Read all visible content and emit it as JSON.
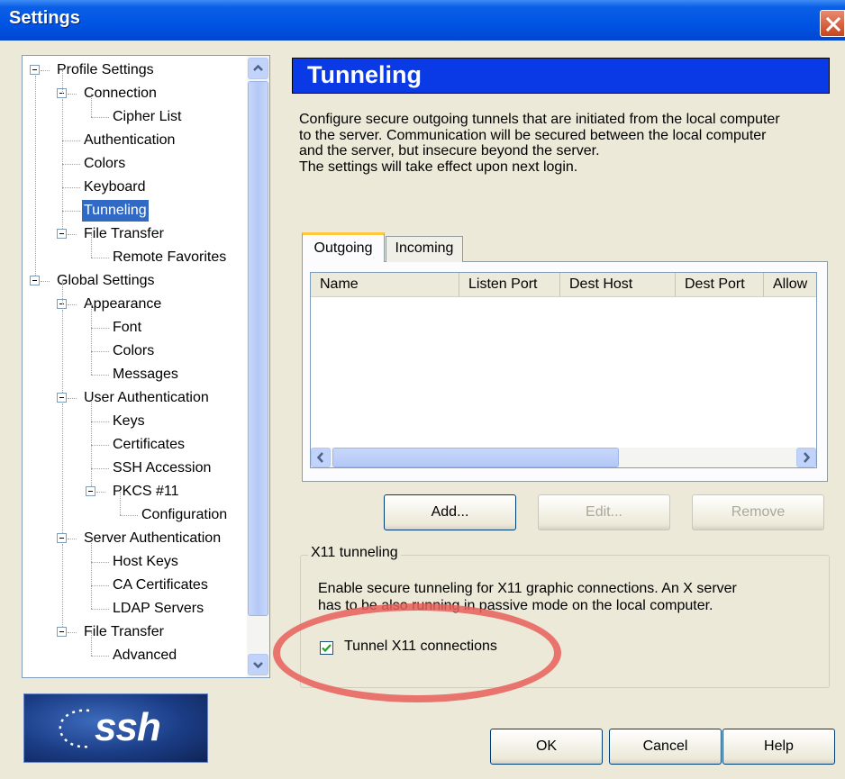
{
  "window": {
    "title": "Settings"
  },
  "tree": {
    "items": [
      {
        "label": "Profile Settings",
        "level": 0
      },
      {
        "label": "Connection",
        "level": 1
      },
      {
        "label": "Cipher List",
        "level": 2
      },
      {
        "label": "Authentication",
        "level": 1
      },
      {
        "label": "Colors",
        "level": 1
      },
      {
        "label": "Keyboard",
        "level": 1
      },
      {
        "label": "Tunneling",
        "level": 1,
        "selected": true
      },
      {
        "label": "File Transfer",
        "level": 1
      },
      {
        "label": "Remote Favorites",
        "level": 2
      },
      {
        "label": "Global Settings",
        "level": 0
      },
      {
        "label": "Appearance",
        "level": 1
      },
      {
        "label": "Font",
        "level": 2
      },
      {
        "label": "Colors",
        "level": 2
      },
      {
        "label": "Messages",
        "level": 2
      },
      {
        "label": "User Authentication",
        "level": 1
      },
      {
        "label": "Keys",
        "level": 2
      },
      {
        "label": "Certificates",
        "level": 2
      },
      {
        "label": "SSH Accession",
        "level": 2
      },
      {
        "label": "PKCS #11",
        "level": 2
      },
      {
        "label": "Configuration",
        "level": 3
      },
      {
        "label": "Server Authentication",
        "level": 1
      },
      {
        "label": "Host Keys",
        "level": 2
      },
      {
        "label": "CA Certificates",
        "level": 2
      },
      {
        "label": "LDAP Servers",
        "level": 2
      },
      {
        "label": "File Transfer",
        "level": 1
      },
      {
        "label": "Advanced",
        "level": 2
      }
    ]
  },
  "logo": {
    "text": "ssh"
  },
  "panel": {
    "title": "Tunneling",
    "description": [
      "Configure secure outgoing tunnels that are initiated from the local computer",
      "to the server. Communication will be secured between the local computer",
      "and the server, but insecure beyond the server.",
      "The settings will take effect upon next login."
    ],
    "tabs": [
      "Outgoing",
      "Incoming"
    ],
    "columns": [
      "Name",
      "Listen Port",
      "Dest Host",
      "Dest Port",
      "Allow"
    ],
    "buttons": {
      "add": "Add...",
      "edit": "Edit...",
      "remove": "Remove"
    }
  },
  "x11": {
    "group_label": "X11 tunneling",
    "text": [
      "Enable secure tunneling for X11 graphic connections. An X server",
      "has to be also running in passive mode on the local computer."
    ],
    "checkbox_label": "Tunnel X11 connections",
    "checked": true
  },
  "footer": {
    "ok": "OK",
    "cancel": "Cancel",
    "help": "Help"
  },
  "colors": {
    "titlebar": "#0054e3",
    "header": "#0a39e6",
    "selection": "#316ac5",
    "annotation": "#e85f5a"
  }
}
